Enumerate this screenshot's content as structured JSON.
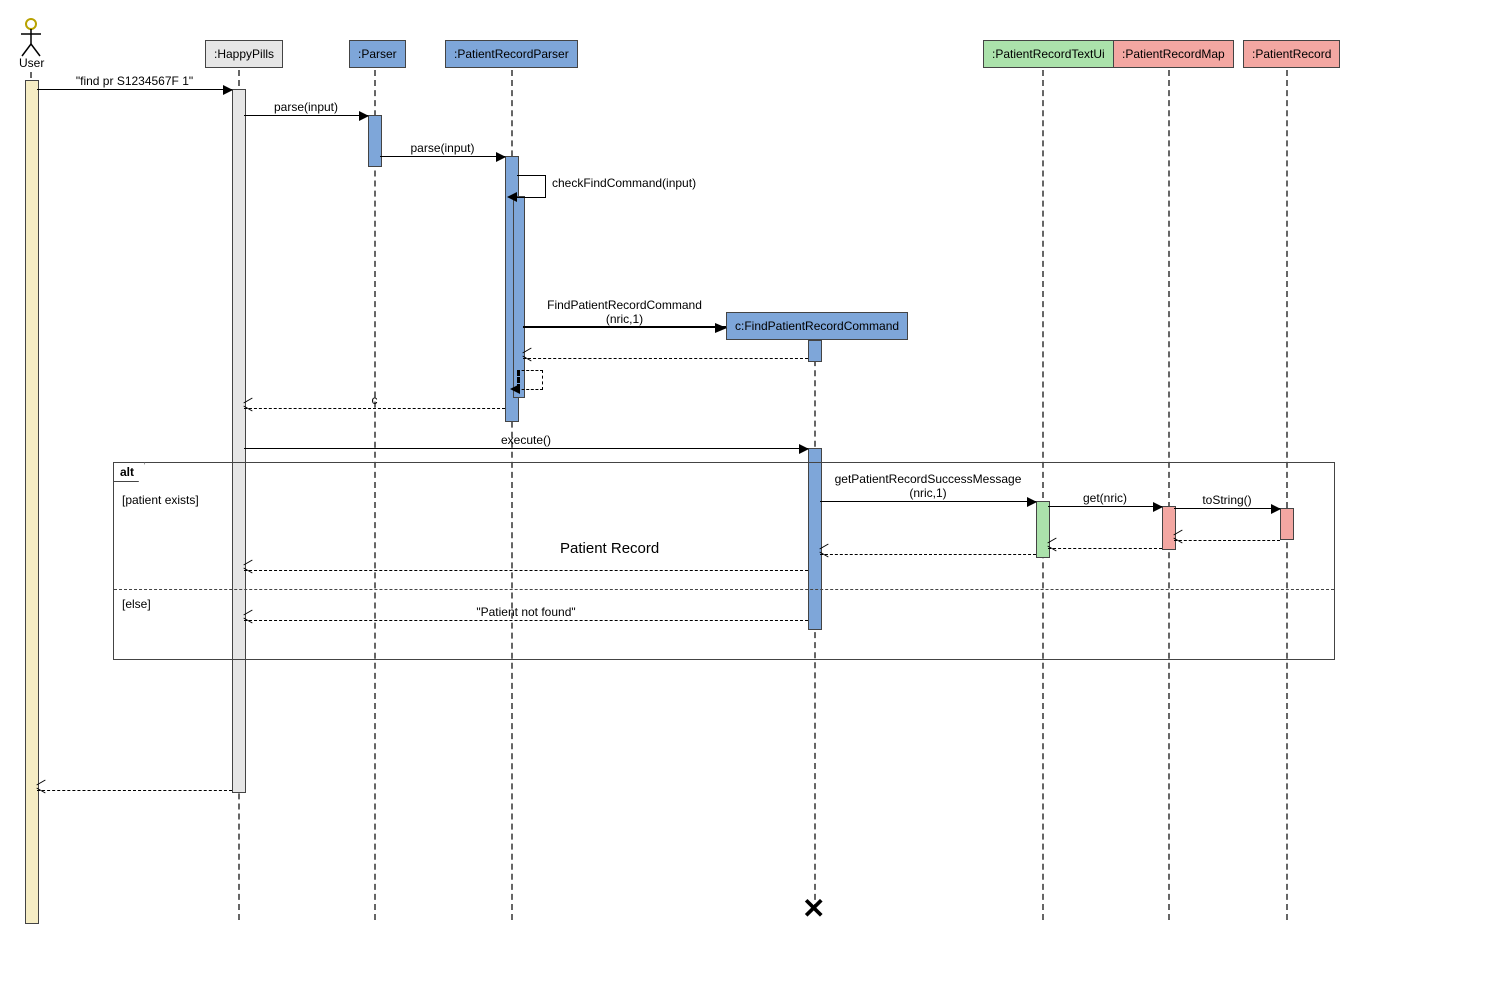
{
  "actor": {
    "name": "User"
  },
  "participants": {
    "happyPills": ":HappyPills",
    "parser": ":Parser",
    "patientRecordParser": ":PatientRecordParser",
    "findCmd": "c:FindPatientRecordCommand",
    "textUi": ":PatientRecordTextUi",
    "recordMap": ":PatientRecordMap",
    "record": ":PatientRecord"
  },
  "messages": {
    "userCmd": "\"find pr S1234567F 1\"",
    "parse1": "parse(input)",
    "parse2": "parse(input)",
    "checkFind": "checkFindCommand(input)",
    "newCmd1": "FindPatientRecordCommand",
    "newCmd2": "(nric,1)",
    "retC": "c",
    "execute": "execute()",
    "getMsg1": "getPatientRecordSuccessMessage",
    "getMsg2": "(nric,1)",
    "get": "get(nric)",
    "toString": "toString()",
    "patientRecord": "Patient Record",
    "notFound": "\"Patient not found\""
  },
  "alt": {
    "label": "alt",
    "guard1": "[patient exists]",
    "guard2": "[else]"
  }
}
